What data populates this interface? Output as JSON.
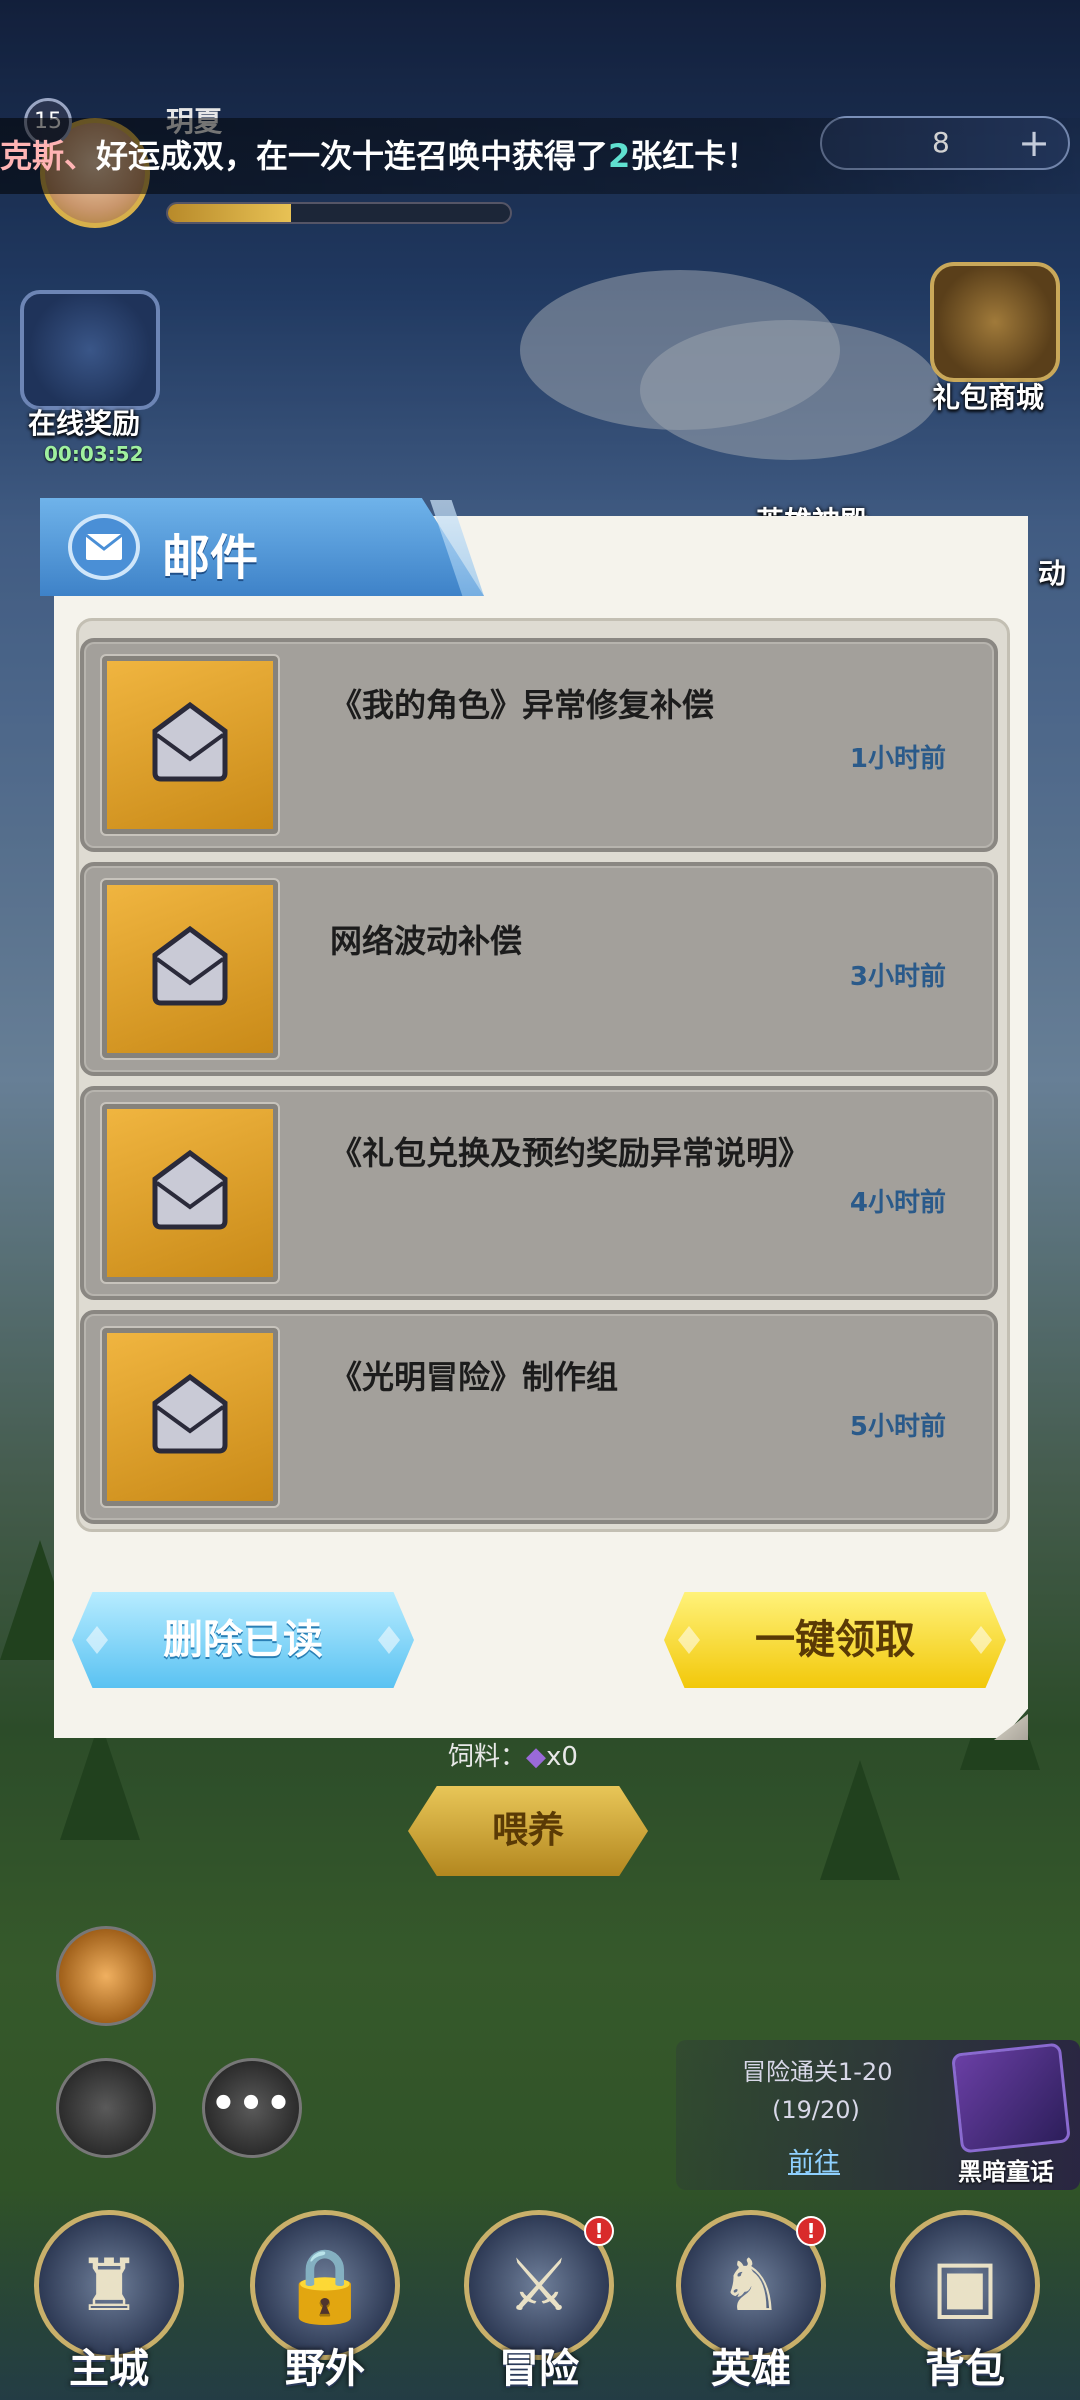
{
  "marquee": {
    "name_part": "克斯、",
    "text_before": "好运成双，在一次十连召唤中获得了",
    "highlight": "2",
    "text_after": "张红卡！"
  },
  "player": {
    "level": "15",
    "name": "玥夏",
    "gems": "8"
  },
  "side": {
    "online_reward": "在线奖励",
    "online_timer": "00:03:52",
    "gift_shop": "礼包商城",
    "hero_temple": "英雄神殿",
    "event_suffix": "动"
  },
  "feed": {
    "label": "饲料：",
    "count": "x0",
    "button": "喂养"
  },
  "quest": {
    "title": "冒险通关1-20",
    "progress": "(19/20)",
    "go": "前往",
    "book": "黑暗童话"
  },
  "nav": [
    {
      "label": "主城",
      "glyph": "♜",
      "alert": false
    },
    {
      "label": "野外",
      "glyph": "🔒",
      "alert": false
    },
    {
      "label": "冒险",
      "glyph": "⚔",
      "alert": true
    },
    {
      "label": "英雄",
      "glyph": "♞",
      "alert": true
    },
    {
      "label": "背包",
      "glyph": "▣",
      "alert": false
    }
  ],
  "mail": {
    "title": "邮件",
    "items": [
      {
        "title": "《我的角色》异常修复补偿",
        "time": "1小时前"
      },
      {
        "title": "网络波动补偿",
        "time": "3小时前"
      },
      {
        "title": "《礼包兑换及预约奖励异常说明》",
        "time": "4小时前"
      },
      {
        "title": "《光明冒险》制作组",
        "time": "5小时前"
      }
    ],
    "delete_read": "删除已读",
    "collect_all": "一键领取"
  },
  "colors": {
    "accent_blue": "#3e82c8",
    "collect_yellow": "#f2c80a",
    "time_blue": "#2a5a8a",
    "alert_red": "#d92b2b"
  }
}
